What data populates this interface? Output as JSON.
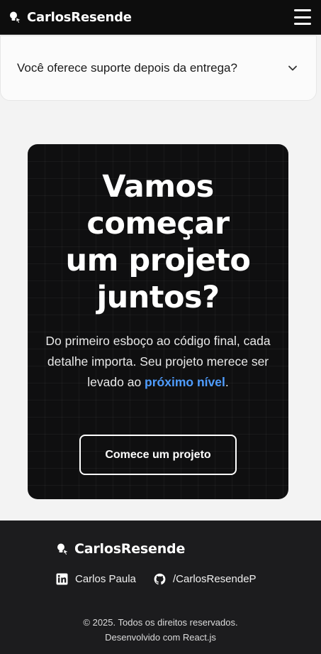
{
  "header": {
    "brand": "CarlosResende",
    "brand_icon": "mouse-pointer-bulb-icon",
    "menu_icon": "hamburger-menu-icon"
  },
  "faq": {
    "question": "Você oferece suporte depois da entrega?",
    "toggle_icon": "chevron-down-icon"
  },
  "cta": {
    "title": "Vamos começar um projeto juntos?",
    "text_before": "Do primeiro esboço ao código final, cada detalhe importa. Seu projeto merece ser levado ao ",
    "highlight": "próximo nível",
    "text_after": ".",
    "button_label": "Comece um projeto",
    "highlight_color": "#4f9dff"
  },
  "footer": {
    "brand": "CarlosResende",
    "linkedin_label": "Carlos Paula",
    "github_label": "/CarlosResendeP",
    "copyright": "© 2025. Todos os direitos reservados.",
    "built_with": "Desenvolvido com React.js"
  }
}
